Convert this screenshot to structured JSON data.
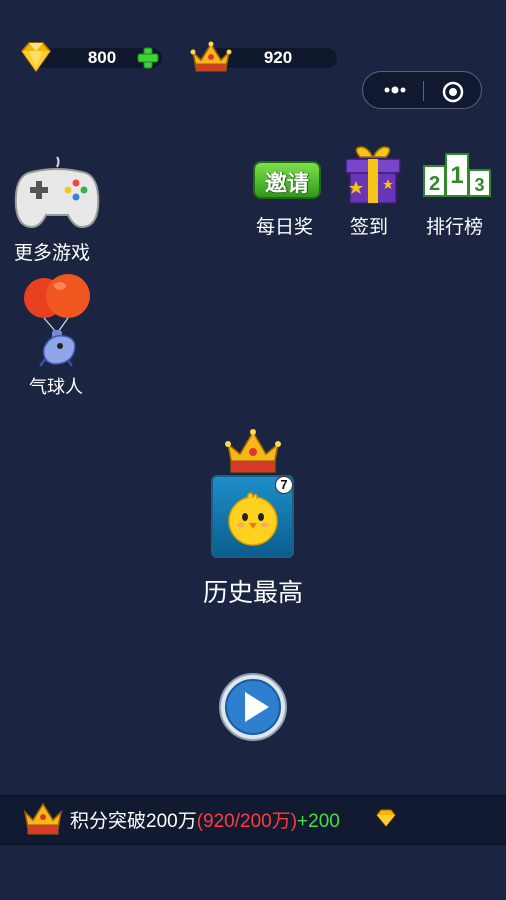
{
  "resources": {
    "gems": "800",
    "crowns": "920"
  },
  "capsule": {
    "more_icon": "more-dots-icon",
    "close_icon": "target-close-icon"
  },
  "menu": {
    "more_games": "更多游戏",
    "balloon_man": "气球人",
    "invite_badge": "邀请",
    "daily_reward": "每日奖",
    "sign_in": "签到",
    "leaderboard": "排行榜",
    "podium_digits": [
      "2",
      "1",
      "3"
    ]
  },
  "record": {
    "level_badge": "7",
    "label": "历史最高"
  },
  "quest": {
    "prefix": "积分突破200万",
    "progress": "(920/200万)",
    "reward": "+200"
  },
  "colors": {
    "background": "#1b2541",
    "accent_green": "#40e040",
    "accent_red": "#ff3c3c",
    "gold": "#f5b81a"
  }
}
